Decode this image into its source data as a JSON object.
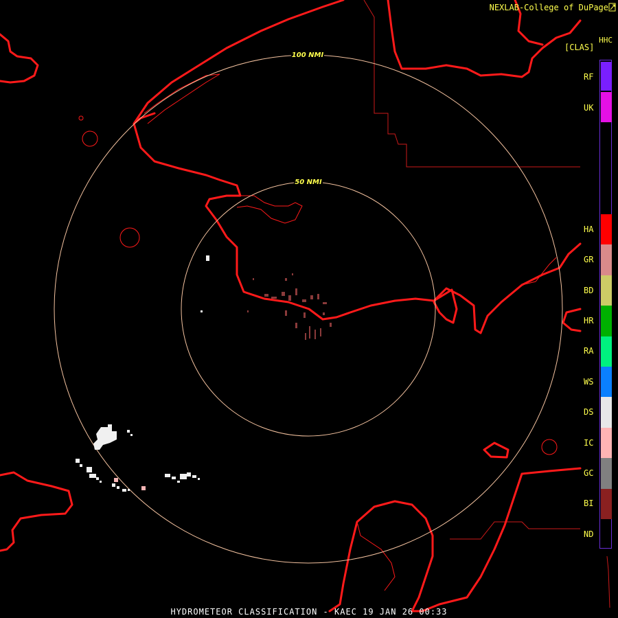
{
  "header": {
    "credit": "NEXLAB-College of DuPage",
    "logo_icon": "nexlab-logo-icon",
    "product": "HHC",
    "unit": "[CLAS]"
  },
  "footer": {
    "title": "HYDROMETEOR CLASSIFICATION - KAEC 19 JAN 26 00:33"
  },
  "map": {
    "range_rings": [
      {
        "label": "100 NMI",
        "range_nmi": 100
      },
      {
        "label": "50 NMI",
        "range_nmi": 50
      }
    ],
    "colors": {
      "coast": "#ff1a1a",
      "border": "#cc1a1a",
      "ring": "#f5c3a0",
      "echo_white": "#f0f0f0",
      "echo_pink": "#f4b4b4",
      "echo_brown": "#8a3a3a"
    }
  },
  "legend": {
    "items": [
      {
        "code": "RF",
        "color": "#7a1fff"
      },
      {
        "code": "UK",
        "color": "#e510e5"
      },
      {
        "code": "HA",
        "color": "#ff0000"
      },
      {
        "code": "GR",
        "color": "#d98a8a"
      },
      {
        "code": "BD",
        "color": "#cccc66"
      },
      {
        "code": "HR",
        "color": "#00b000"
      },
      {
        "code": "RA",
        "color": "#00f07f"
      },
      {
        "code": "WS",
        "color": "#0a80ff"
      },
      {
        "code": "DS",
        "color": "#e8e8e8"
      },
      {
        "code": "IC",
        "color": "#ffb4b4"
      },
      {
        "code": "GC",
        "color": "#808080"
      },
      {
        "code": "BI",
        "color": "#8a2020"
      },
      {
        "code": "ND",
        "color": "#000000"
      }
    ]
  }
}
